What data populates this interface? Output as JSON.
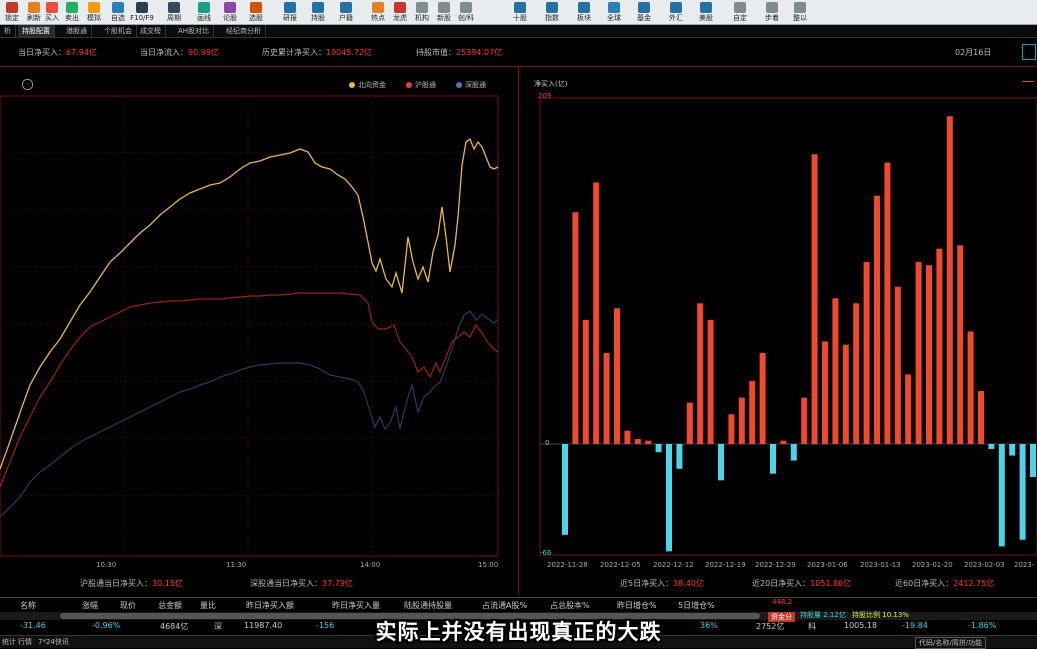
{
  "toolbar": {
    "items": [
      {
        "label": "锁定",
        "color": "#c0392b"
      },
      {
        "label": "刷新",
        "color": "#e67e22"
      },
      {
        "label": "买入",
        "color": "#e74c3c"
      },
      {
        "label": "卖出",
        "color": "#27ae60"
      },
      {
        "label": "模拟",
        "color": "#f39c12"
      },
      {
        "label": "自选",
        "color": "#2980b9"
      },
      {
        "label": "F10/F9",
        "color": "#2c3e50"
      },
      {
        "label": "周期",
        "color": "#34495e"
      },
      {
        "label": "画线",
        "color": "#16a085"
      },
      {
        "label": "论股",
        "color": "#8e44ad"
      },
      {
        "label": "选股",
        "color": "#d35400"
      },
      {
        "label": "研报",
        "color": "#2471a3"
      },
      {
        "label": "持股",
        "color": "#2471a3"
      },
      {
        "label": "户籍",
        "color": "#2471a3"
      },
      {
        "label": "热点",
        "color": "#e67e22"
      },
      {
        "label": "龙虎",
        "color": "#c0392b"
      },
      {
        "label": "机构",
        "color": "#7f8c8d"
      },
      {
        "label": "新股",
        "color": "#7f8c8d"
      },
      {
        "label": "创/科",
        "color": "#7f8c8d"
      },
      {
        "label": "十股",
        "color": "#2471a3"
      },
      {
        "label": "指数",
        "color": "#2471a3"
      },
      {
        "label": "板块",
        "color": "#2471a3"
      },
      {
        "label": "全球",
        "color": "#2980b9"
      },
      {
        "label": "基金",
        "color": "#2471a3"
      },
      {
        "label": "外汇",
        "color": "#2471a3"
      },
      {
        "label": "美股",
        "color": "#2471a3"
      },
      {
        "label": "自定",
        "color": "#7f8c8d"
      },
      {
        "label": "步着",
        "color": "#7f8c8d"
      },
      {
        "label": "整以",
        "color": "#7f8c8d"
      }
    ]
  },
  "tabs": [
    "析",
    "持股配置",
    "港股通",
    "个股机会",
    "成交榜",
    "AH股对比",
    "经纪商分析"
  ],
  "stats": {
    "today_net_buy_label": "当日净买入：",
    "today_net_buy": "67.94亿",
    "today_net_inflow_label": "当日净流入：",
    "today_net_inflow": "90.99亿",
    "hist_net_buy_label": "历史累计净买入：",
    "hist_net_buy": "19045.72亿",
    "holding_value_label": "持股市值：",
    "holding_value": "25394.07亿",
    "date": "02月16日"
  },
  "left_chart": {
    "legend": [
      "北向资金",
      "沪股通",
      "深股通"
    ],
    "x_ticks": [
      "10:30",
      "11:30",
      "14:00",
      "15:00"
    ],
    "footer_sh_label": "沪股通当日净买入：",
    "footer_sh": "30.15亿",
    "footer_sz_label": "深股通当日净买入：",
    "footer_sz": "37.79亿"
  },
  "chart_data": {
    "type": "bar",
    "ylabel": "净买入(亿)",
    "ylim": [
      -66,
      209
    ],
    "y_ticks": [
      "209",
      "0",
      "-66"
    ],
    "x_ticks": [
      "2022-11-28",
      "2022-12-05",
      "2022-12-12",
      "2022-12-19",
      "2022-12-29",
      "2023-01-06",
      "2023-01-13",
      "2023-01-20",
      "2023-02-03",
      "2023-"
    ],
    "values": [
      -55,
      140,
      75,
      158,
      55,
      82,
      8,
      3,
      2,
      -5,
      -65,
      -15,
      25,
      85,
      75,
      -22,
      18,
      28,
      38,
      55,
      -18,
      2,
      -10,
      28,
      175,
      62,
      88,
      60,
      85,
      110,
      150,
      170,
      95,
      42,
      110,
      108,
      118,
      198,
      120,
      68,
      32,
      -3,
      -62,
      -7,
      -58,
      -20,
      -2,
      168,
      -50
    ],
    "footer_5d_label": "近5日净买入：",
    "footer_5d": "38.40亿",
    "footer_20d_label": "近20日净买入：",
    "footer_20d": "1051.86亿",
    "footer_60d_label": "近60日净买入：",
    "footer_60d": "2412.75亿"
  },
  "table": {
    "headers": [
      "名称",
      "涨幅",
      "现价",
      "总金额",
      "量比",
      "昨日净买入额",
      "昨日净买入量",
      "陆股通持股量",
      "占流通A股%",
      "占总股本%",
      "昨日增仓%",
      "5日增仓%"
    ],
    "row": [
      "-31.46",
      "-0.96%",
      "4684亿",
      "深",
      "11987.40",
      "-156",
      "36%",
      "2752亿",
      "科",
      "1005.18",
      "-19.84",
      "-1.86%"
    ],
    "side_tag": "资金分",
    "side_a": "持股量",
    "side_a_val": "2.12亿",
    "side_b": "持股比例",
    "side_b_val": "10.13%",
    "side_top": "448.2"
  },
  "statusbar": {
    "left": "统计",
    "mid": "行情",
    "mid2": "7*24快讯",
    "right": "代码/名称/简拼/功能"
  },
  "subtitle": "实际上并没有出现真正的大跌"
}
